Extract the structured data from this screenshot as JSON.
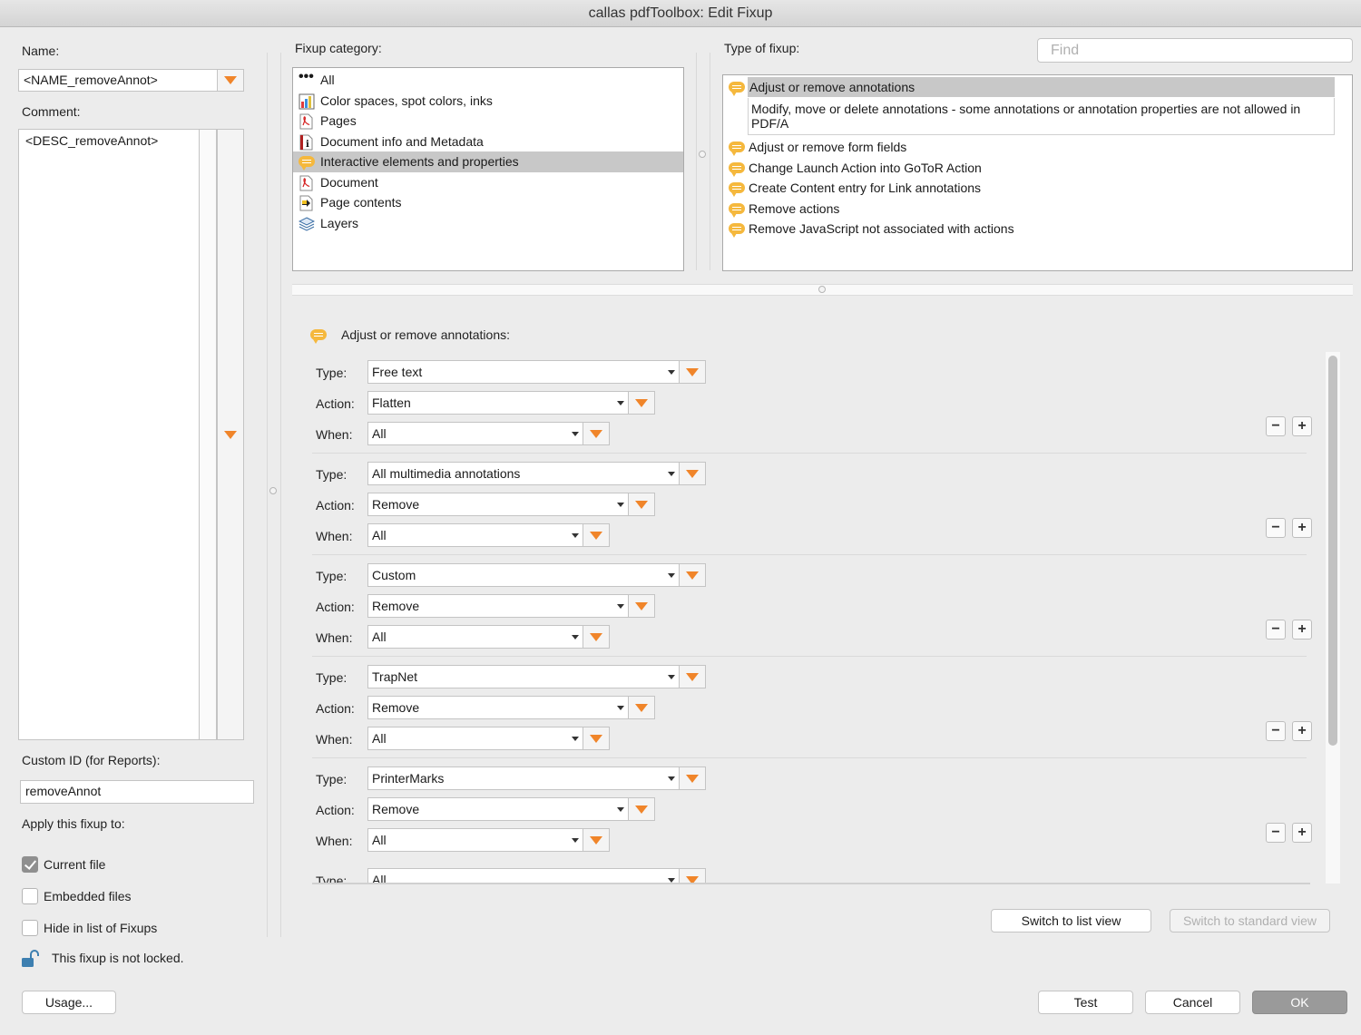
{
  "window": {
    "title": "callas pdfToolbox: Edit Fixup"
  },
  "left": {
    "name_label": "Name:",
    "name_value": "<NAME_removeAnnot>",
    "comment_label": "Comment:",
    "comment_value": "<DESC_removeAnnot>",
    "custom_id_label": "Custom ID (for Reports):",
    "custom_id_value": "removeAnnot",
    "apply_label": "Apply this fixup to:",
    "checkboxes": [
      {
        "label": "Current file",
        "checked": true
      },
      {
        "label": "Embedded files",
        "checked": false
      },
      {
        "label": "Hide in list of Fixups",
        "checked": false
      }
    ],
    "lock_text": "This fixup is not locked.",
    "usage_button": "Usage..."
  },
  "category": {
    "label": "Fixup category:",
    "items": [
      {
        "label": "All",
        "icon": "dots-icon"
      },
      {
        "label": "Color spaces, spot colors, inks",
        "icon": "color-icon"
      },
      {
        "label": "Pages",
        "icon": "pdf-icon"
      },
      {
        "label": "Document info and Metadata",
        "icon": "info-icon"
      },
      {
        "label": "Interactive elements and properties",
        "icon": "annotation-icon",
        "selected": true
      },
      {
        "label": "Document",
        "icon": "pdf-icon"
      },
      {
        "label": "Page contents",
        "icon": "page-contents-icon"
      },
      {
        "label": "Layers",
        "icon": "layers-icon"
      }
    ]
  },
  "fixup_type": {
    "label": "Type of fixup:",
    "find_placeholder": "Find",
    "selected_title": "Adjust or remove annotations",
    "selected_desc": "Modify, move or delete annotations - some annotations or annotation properties are not allowed in PDF/A",
    "items": [
      "Adjust or remove form fields",
      "Change Launch Action into GoToR Action",
      "Create Content entry for Link annotations",
      "Remove actions",
      "Remove JavaScript not associated with actions"
    ]
  },
  "detail": {
    "heading": "Adjust or remove annotations:",
    "type_label": "Type:",
    "action_label": "Action:",
    "when_label": "When:",
    "groups": [
      {
        "type": "Free text",
        "action": "Flatten",
        "when": "All"
      },
      {
        "type": "All multimedia annotations",
        "action": "Remove",
        "when": "All"
      },
      {
        "type": "Custom",
        "action": "Remove",
        "when": "All"
      },
      {
        "type": "TrapNet",
        "action": "Remove",
        "when": "All"
      },
      {
        "type": "PrinterMarks",
        "action": "Remove",
        "when": "All"
      }
    ],
    "partial_type": "All",
    "minus": "−",
    "plus": "+"
  },
  "view_buttons": {
    "list": "Switch to list view",
    "standard": "Switch to standard view"
  },
  "footer": {
    "test": "Test",
    "cancel": "Cancel",
    "ok": "OK"
  }
}
